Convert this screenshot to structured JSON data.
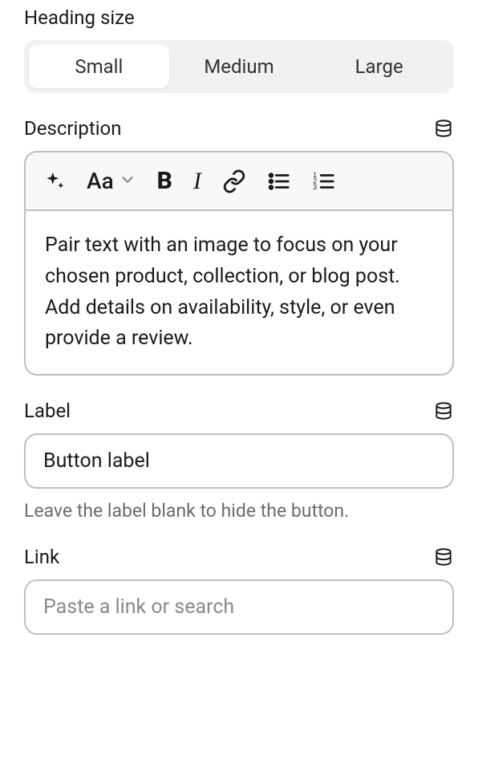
{
  "heading_size": {
    "label": "Heading size",
    "options": [
      "Small",
      "Medium",
      "Large"
    ],
    "selected": "Small"
  },
  "description": {
    "label": "Description",
    "content": "Pair text with an image to focus on your chosen product, collection, or blog post. Add details on availability, style, or even provide a review."
  },
  "button_label": {
    "label": "Label",
    "value": "Button label",
    "help": "Leave the label blank to hide the button."
  },
  "link": {
    "label": "Link",
    "placeholder": "Paste a link or search",
    "value": ""
  }
}
